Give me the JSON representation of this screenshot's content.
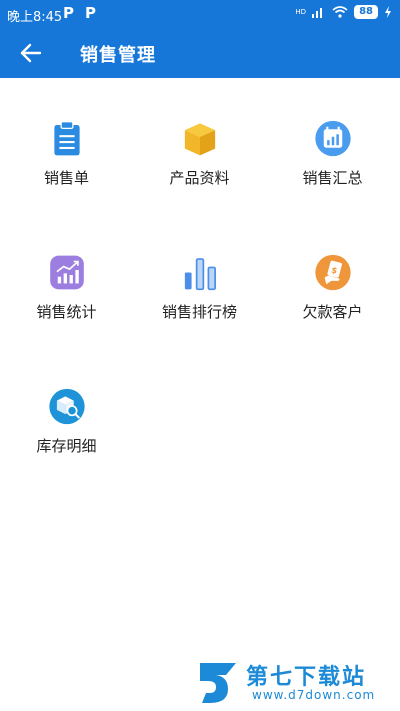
{
  "status_bar": {
    "time": "晚上8:45",
    "notif1": "P",
    "notif2": "P",
    "network": "HD",
    "battery": "88"
  },
  "app_bar": {
    "title": "销售管理",
    "back_icon": "arrow-left-icon"
  },
  "menu": [
    {
      "label": "销售单",
      "icon": "clipboard-icon",
      "color": "#2a8be0"
    },
    {
      "label": "产品资料",
      "icon": "box-icon",
      "color": "#f1b62a"
    },
    {
      "label": "销售汇总",
      "icon": "calendar-chart-icon",
      "color": "#4a9cef"
    },
    {
      "label": "销售统计",
      "icon": "trend-chart-icon",
      "color": "#9b7ee0"
    },
    {
      "label": "销售排行榜",
      "icon": "bar-ranking-icon",
      "color": "#4a8ee8"
    },
    {
      "label": "欠款客户",
      "icon": "money-hand-icon",
      "color": "#f0963a"
    },
    {
      "label": "库存明细",
      "icon": "inventory-search-icon",
      "color": "#1e93d8"
    }
  ],
  "watermark": {
    "text": "第七下载站",
    "url": "www.d7down.com"
  },
  "colors": {
    "primary": "#1677d8",
    "background": "#ffffff"
  }
}
